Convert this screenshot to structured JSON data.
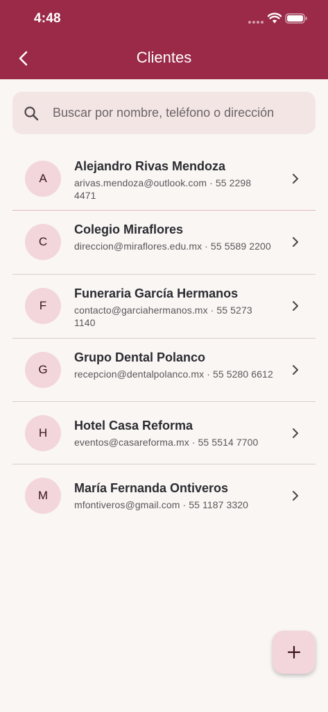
{
  "status_bar": {
    "time": "4:48"
  },
  "header": {
    "title": "Clientes"
  },
  "search": {
    "placeholder": "Buscar por nombre, teléfono o dirección",
    "value": ""
  },
  "clients": [
    {
      "initial": "A",
      "name": "Alejandro Rivas Mendoza",
      "detail": "arivas.mendoza@outlook.com · 55 2298 4471"
    },
    {
      "initial": "C",
      "name": "Colegio Miraflores",
      "detail": "direccion@miraflores.edu.mx · 55 5589 2200"
    },
    {
      "initial": "F",
      "name": "Funeraria García Hermanos",
      "detail": "contacto@garciahermanos.mx · 55 5273 1140"
    },
    {
      "initial": "G",
      "name": "Grupo Dental Polanco",
      "detail": "recepcion@dentalpolanco.mx · 55 5280 6612"
    },
    {
      "initial": "H",
      "name": "Hotel Casa Reforma",
      "detail": "eventos@casareforma.mx · 55 5514 7700"
    },
    {
      "initial": "M",
      "name": "María Fernanda Ontiveros",
      "detail": "mfontiveros@gmail.com · 55 1187 3320"
    }
  ],
  "colors": {
    "app_bar": "#9a2a48",
    "background": "#f9f6f4",
    "search_bg": "#f3e5e4",
    "avatar_bg": "#f3d6dc"
  }
}
